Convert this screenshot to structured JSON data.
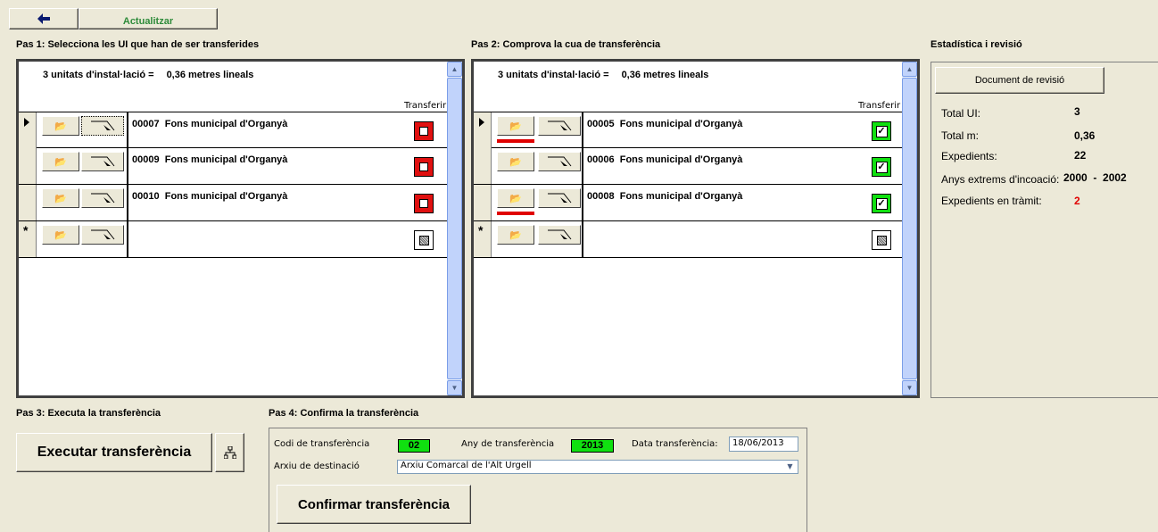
{
  "toolbar": {
    "back_icon": "back-arrow-icon",
    "refresh_label": "Actualitzar"
  },
  "step1": {
    "title": "Pas 1: Selecciona les UI que han de ser transferides",
    "summary_units": "3 unitats d'instal·lació =",
    "summary_meters": "0,36 metres lineals",
    "column_header": "Transferir",
    "rows": [
      {
        "code": "00007",
        "name": "Fons municipal d'Organyà",
        "transfer": false
      },
      {
        "code": "00009",
        "name": "Fons municipal d'Organyà",
        "transfer": false
      },
      {
        "code": "00010",
        "name": "Fons municipal d'Organyà",
        "transfer": false
      }
    ]
  },
  "step2": {
    "title": "Pas 2: Comprova la cua de transferència",
    "summary_units": "3 unitats d'instal·lació =",
    "summary_meters": "0,36 metres lineals",
    "column_header": "Transferir",
    "rows": [
      {
        "code": "00005",
        "name": "Fons municipal d'Organyà",
        "transfer": true
      },
      {
        "code": "00006",
        "name": "Fons municipal d'Organyà",
        "transfer": true
      },
      {
        "code": "00008",
        "name": "Fons municipal d'Organyà",
        "transfer": true
      }
    ]
  },
  "stats": {
    "title": "Estadística i revisió",
    "review_button": "Document de revisió",
    "total_ui_label": "Total UI:",
    "total_ui_value": "3",
    "total_m_label": "Total m:",
    "total_m_value": "0,36",
    "expedients_label": "Expedients:",
    "expedients_value": "22",
    "anys_label": "Anys extrems d'incoació:",
    "anys_value": "2000  -  2002",
    "tramit_label": "Expedients en tràmit:",
    "tramit_value": "2",
    "tramit_color": "#e00000"
  },
  "step3": {
    "title": "Pas 3: Executa la transferència",
    "execute_button": "Executar transferència",
    "tree_icon": "hierarchy-icon"
  },
  "step4": {
    "title": "Pas 4: Confirma la transferència",
    "codi_label": "Codi de transferència",
    "codi_value": "02",
    "any_label": "Any de transferència",
    "any_value": "2013",
    "data_label": "Data transferència:",
    "data_value": "18/06/2013",
    "arxiu_label": "Arxiu de destinació",
    "arxiu_value": "Arxiu Comarcal de l'Alt Urgell",
    "confirm_button": "Confirmar transferència"
  },
  "colors": {
    "background": "#ece9d8",
    "checkbox_off": "#e01010",
    "checkbox_on": "#10e010",
    "highlight_field": "#10e010"
  }
}
